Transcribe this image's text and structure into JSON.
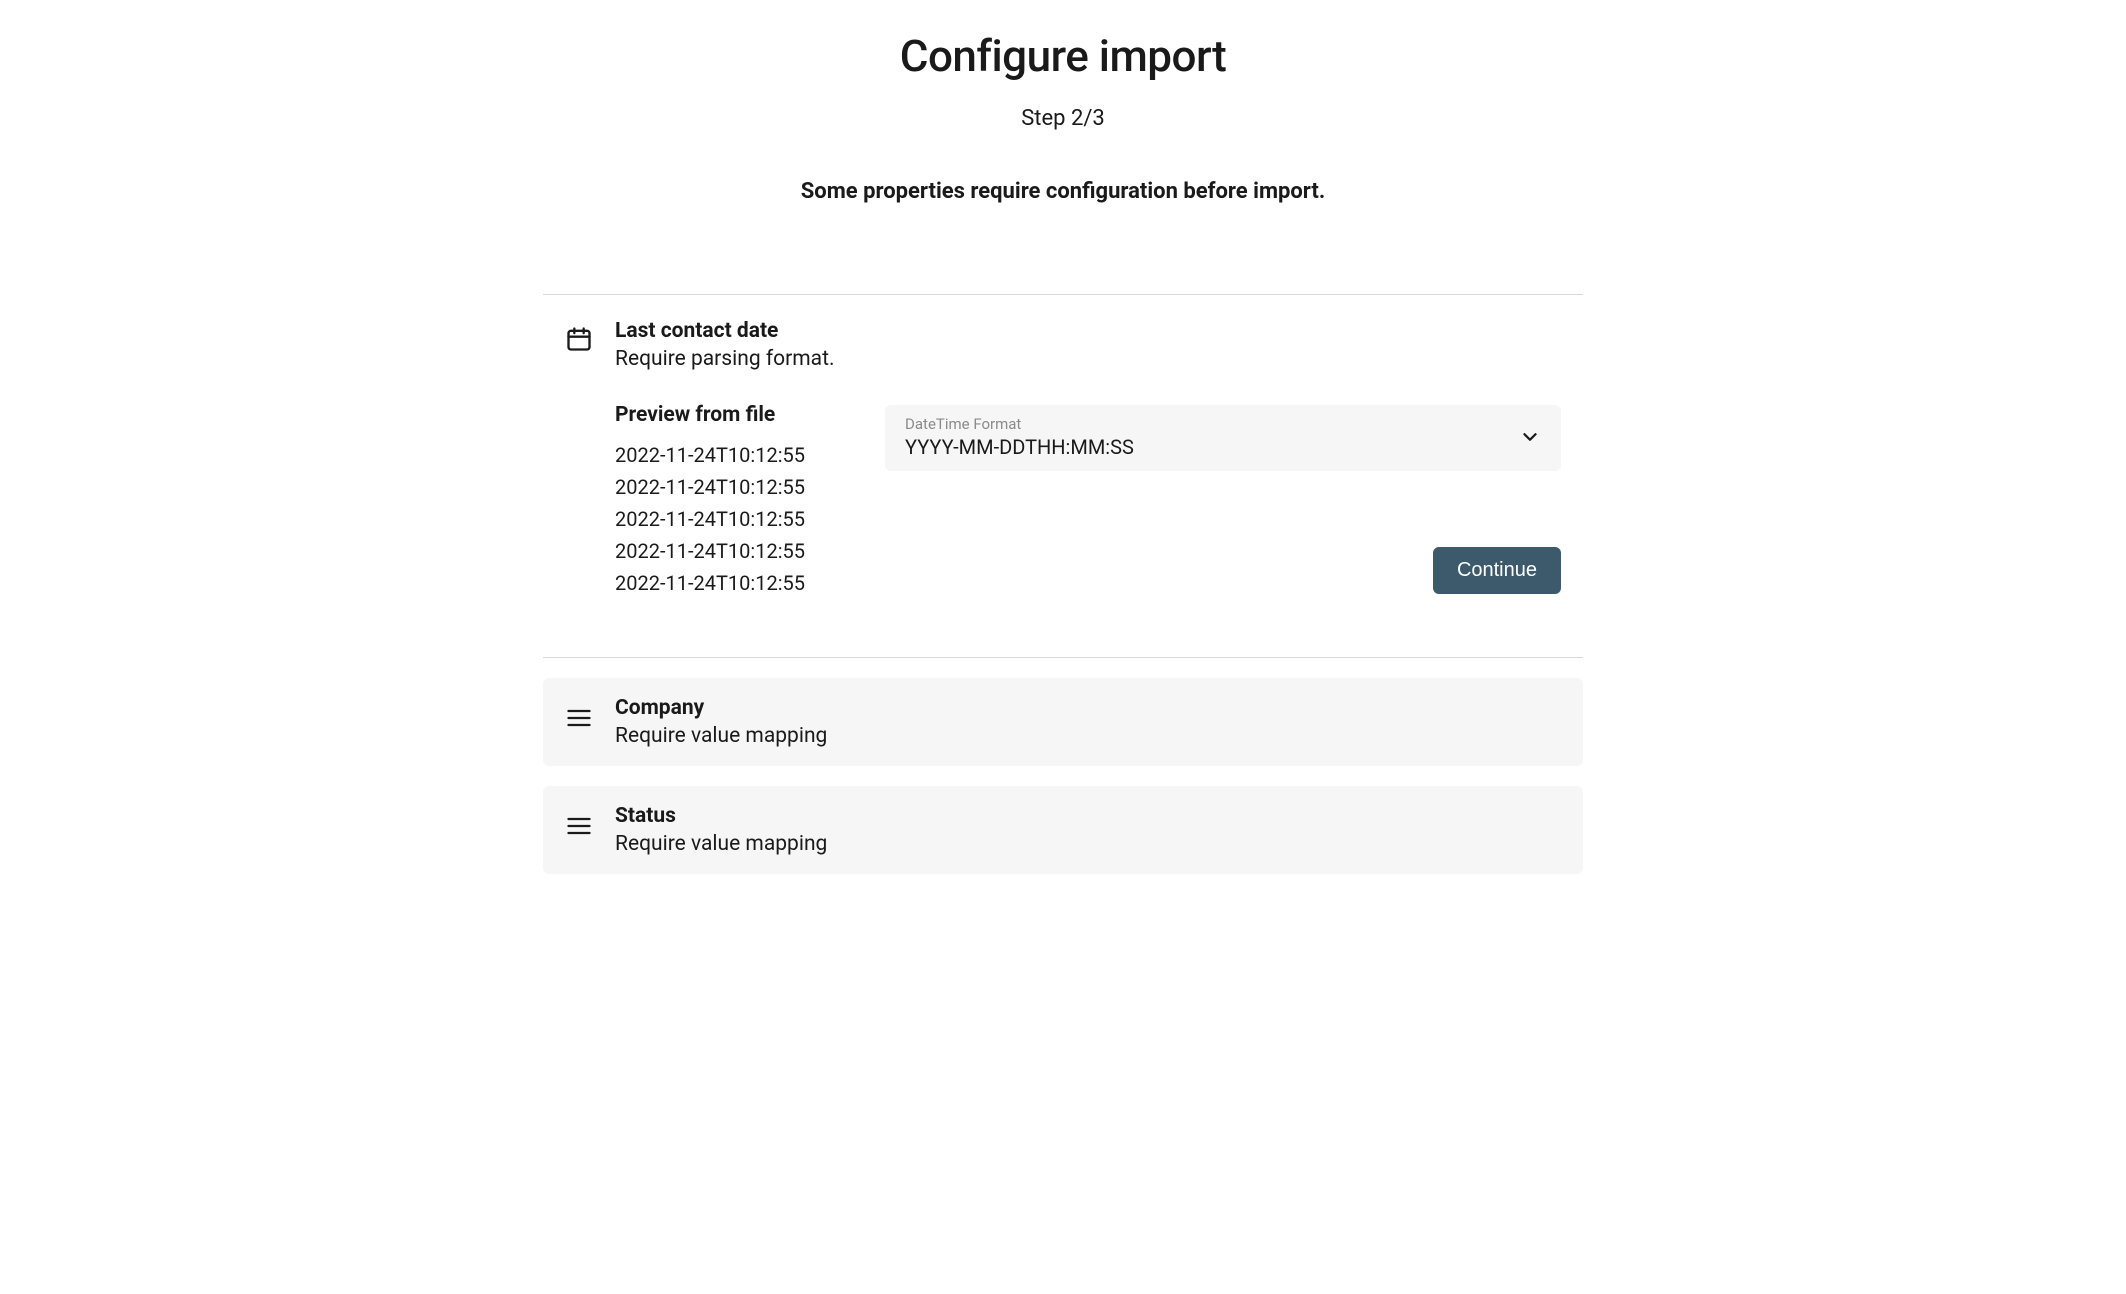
{
  "header": {
    "title": "Configure import",
    "step": "Step 2/3",
    "subtitle": "Some properties require configuration before import."
  },
  "properties": [
    {
      "icon": "calendar",
      "name": "Last contact date",
      "desc": "Require parsing format.",
      "expanded": true,
      "preview_title": "Preview from file",
      "preview_rows": [
        "2022-11-24T10:12:55",
        "2022-11-24T10:12:55",
        "2022-11-24T10:12:55",
        "2022-11-24T10:12:55",
        "2022-11-24T10:12:55"
      ],
      "select_label": "DateTime Format",
      "select_value": "YYYY-MM-DDTHH:MM:SS",
      "continue_label": "Continue"
    },
    {
      "icon": "menu",
      "name": "Company",
      "desc": "Require value mapping",
      "expanded": false
    },
    {
      "icon": "menu",
      "name": "Status",
      "desc": "Require value mapping",
      "expanded": false
    }
  ]
}
